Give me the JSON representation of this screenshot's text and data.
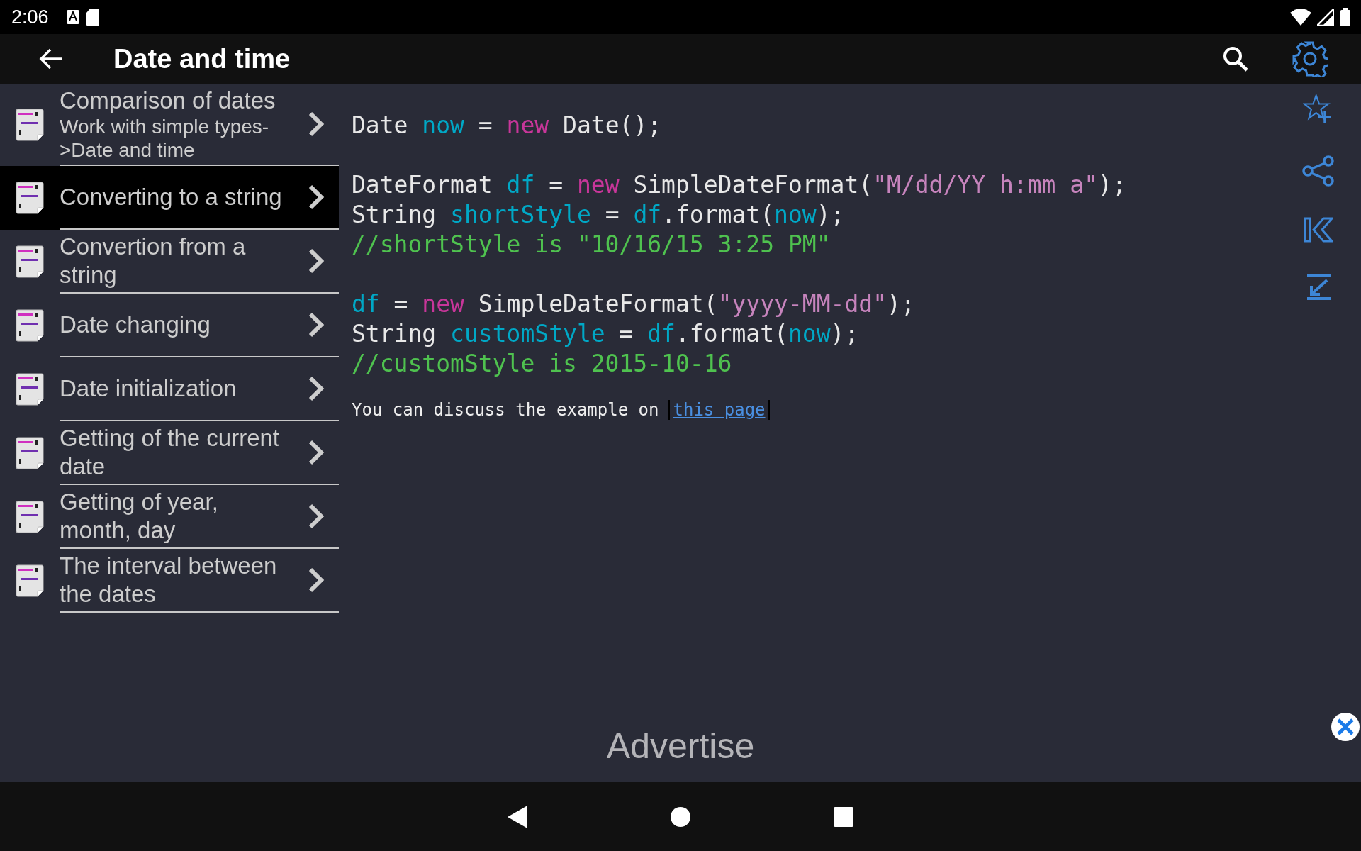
{
  "status_bar": {
    "time": "2:06"
  },
  "app_bar": {
    "title": "Date and time"
  },
  "sidebar": {
    "items": [
      {
        "title": "Comparison of dates",
        "subtitle": "Work with simple types->Date and time",
        "selected": false
      },
      {
        "title": "Converting to a string",
        "selected": true
      },
      {
        "title": "Convertion from a string",
        "selected": false
      },
      {
        "title": "Date changing",
        "selected": false
      },
      {
        "title": "Date initialization",
        "selected": false
      },
      {
        "title": "Getting of the current date",
        "selected": false
      },
      {
        "title": "Getting of year, month, day",
        "selected": false
      },
      {
        "title": "The interval between the dates",
        "selected": false
      }
    ]
  },
  "code_blocks": [
    {
      "lines": [
        [
          {
            "text": "Date ",
            "kind": "plain"
          },
          {
            "text": "now",
            "kind": "variable"
          },
          {
            "text": " = ",
            "kind": "plain"
          },
          {
            "text": "new",
            "kind": "keyword"
          },
          {
            "text": " Date();",
            "kind": "plain"
          }
        ]
      ]
    },
    {
      "lines": [
        [
          {
            "text": "DateFormat ",
            "kind": "plain"
          },
          {
            "text": "df",
            "kind": "variable"
          },
          {
            "text": " = ",
            "kind": "plain"
          },
          {
            "text": "new",
            "kind": "keyword"
          },
          {
            "text": " SimpleDateFormat(",
            "kind": "plain"
          },
          {
            "text": "\"M/dd/YY h:mm a\"",
            "kind": "string"
          },
          {
            "text": ");",
            "kind": "plain"
          }
        ],
        [
          {
            "text": "String ",
            "kind": "plain"
          },
          {
            "text": "shortStyle",
            "kind": "variable"
          },
          {
            "text": " = ",
            "kind": "plain"
          },
          {
            "text": "df",
            "kind": "variable"
          },
          {
            "text": ".format(",
            "kind": "plain"
          },
          {
            "text": "now",
            "kind": "variable"
          },
          {
            "text": ");",
            "kind": "plain"
          }
        ],
        [
          {
            "text": "//shortStyle is \"10/16/15 3:25 PM\"",
            "kind": "comment"
          }
        ]
      ]
    },
    {
      "lines": [
        [
          {
            "text": "df",
            "kind": "variable"
          },
          {
            "text": " = ",
            "kind": "plain"
          },
          {
            "text": "new",
            "kind": "keyword"
          },
          {
            "text": " SimpleDateFormat(",
            "kind": "plain"
          },
          {
            "text": "\"yyyy-MM-dd\"",
            "kind": "string"
          },
          {
            "text": ");",
            "kind": "plain"
          }
        ],
        [
          {
            "text": "String ",
            "kind": "plain"
          },
          {
            "text": "customStyle",
            "kind": "variable"
          },
          {
            "text": " = ",
            "kind": "plain"
          },
          {
            "text": "df",
            "kind": "variable"
          },
          {
            "text": ".format(",
            "kind": "plain"
          },
          {
            "text": "now",
            "kind": "variable"
          },
          {
            "text": ");",
            "kind": "plain"
          }
        ],
        [
          {
            "text": "//customStyle is 2015-10-16",
            "kind": "comment"
          }
        ]
      ]
    }
  ],
  "discussion": {
    "text": "You can discuss the example on",
    "link": "this page"
  },
  "ad": {
    "label": "Advertise"
  }
}
